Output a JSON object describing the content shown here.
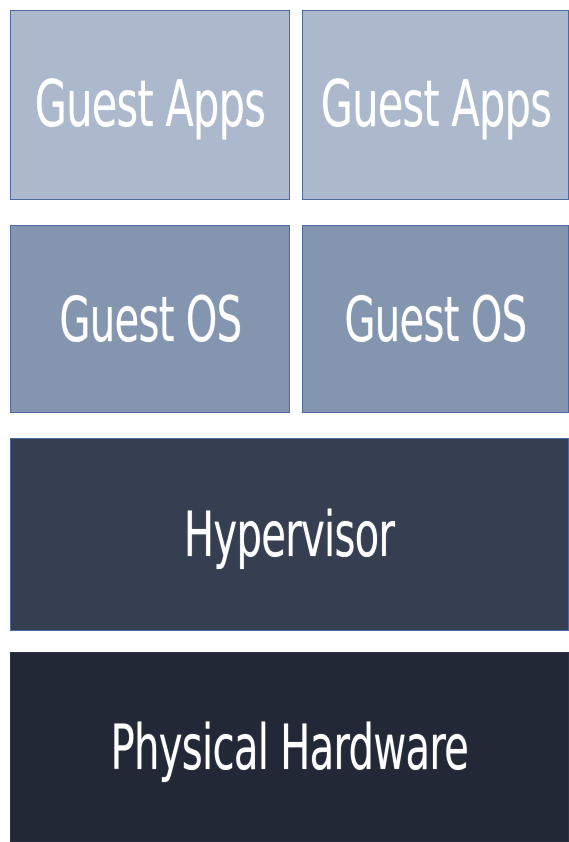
{
  "layers": {
    "guest_apps_left": {
      "label": "Guest Apps",
      "color": "#acb8cc"
    },
    "guest_apps_right": {
      "label": "Guest Apps",
      "color": "#acb8cc"
    },
    "guest_os_left": {
      "label": "Guest OS",
      "color": "#8495af"
    },
    "guest_os_right": {
      "label": "Guest OS",
      "color": "#8495af"
    },
    "hypervisor": {
      "label": "Hypervisor",
      "color": "#353f51"
    },
    "physical_hardware": {
      "label": "Physical Hardware",
      "color": "#222835"
    }
  }
}
